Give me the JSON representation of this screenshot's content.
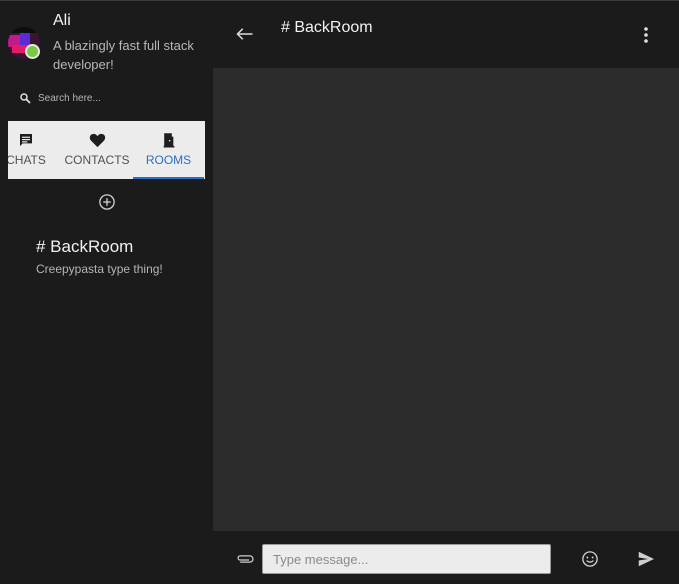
{
  "user": {
    "name": "Ali",
    "bio": "A blazingly fast full stack developer!",
    "status_color": "#7ac943"
  },
  "search": {
    "placeholder": "Search here...",
    "icon": "search-icon"
  },
  "tabs": [
    {
      "label": "CHATS",
      "icon": "chat-icon",
      "active": false
    },
    {
      "label": "CONTACTS",
      "icon": "heart-icon",
      "active": false
    },
    {
      "label": "ROOMS",
      "icon": "door-icon",
      "active": true
    }
  ],
  "rooms": [
    {
      "name": "# BackRoom",
      "description": "Creepypasta type thing!"
    }
  ],
  "chat": {
    "title": "# BackRoom"
  },
  "composer": {
    "placeholder": "Type message..."
  },
  "colors": {
    "accent": "#2a6fc4",
    "background": "#1b1b1b",
    "message_area": "#2c2c2c"
  }
}
